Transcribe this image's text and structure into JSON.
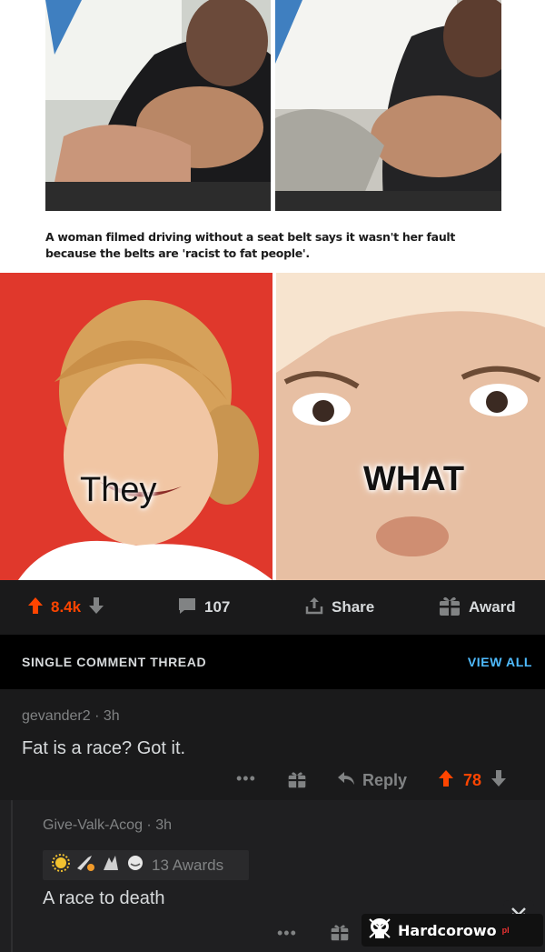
{
  "news": {
    "caption_line1": "A woman filmed driving without a seat belt says it wasn't her fault",
    "caption_line2": "because the belts are 'racist to fat people'."
  },
  "meme": {
    "left_text": "They",
    "right_text": "WHAT"
  },
  "post_actions": {
    "upvotes": "8.4k",
    "comments": "107",
    "share": "Share",
    "award": "Award",
    "upvote_color": "#ff4500"
  },
  "thread": {
    "title": "SINGLE COMMENT THREAD",
    "view_all": "VIEW ALL"
  },
  "comments": [
    {
      "author": "gevander2",
      "age": "3h",
      "body": "Fat is a race?  Got it.",
      "reply": "Reply",
      "score": "78"
    },
    {
      "author": "Give-Valk-Acog",
      "age": "3h",
      "awards": "13 Awards",
      "body": "A race to death"
    }
  ],
  "watermark": {
    "text": "Hardcorowo",
    "suffix": "pl"
  },
  "colors": {
    "accent_blue": "#4fbcff",
    "upvote_orange": "#ff4500",
    "card_bg": "#1a1a1b"
  },
  "icons": [
    "upvote-icon",
    "downvote-icon",
    "comment-icon",
    "share-icon",
    "gift-icon",
    "reply-icon",
    "more-icon",
    "skull-icon",
    "chevron-icon"
  ]
}
